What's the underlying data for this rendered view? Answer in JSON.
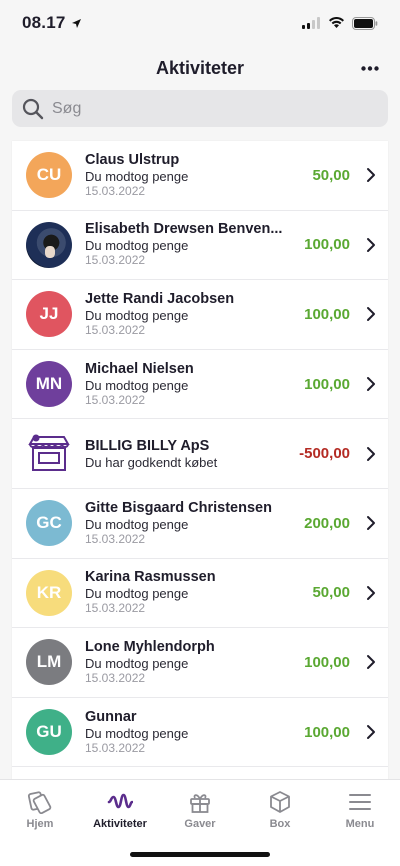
{
  "status_bar": {
    "time": "08.17"
  },
  "header": {
    "title": "Aktiviteter",
    "more_label": "•••"
  },
  "search": {
    "placeholder": "Søg"
  },
  "activities": [
    {
      "initials": "CU",
      "avatar_color": "#f3a65a",
      "name": "Claus Ulstrup",
      "description": "Du modtog penge",
      "date": "15.03.2022",
      "amount": "50,00",
      "type": "positive"
    },
    {
      "initials": "",
      "avatar_color": "photo",
      "name": "Elisabeth Drewsen Benven...",
      "description": "Du modtog penge",
      "date": "15.03.2022",
      "amount": "100,00",
      "type": "positive"
    },
    {
      "initials": "JJ",
      "avatar_color": "#e05560",
      "name": "Jette Randi Jacobsen",
      "description": "Du modtog penge",
      "date": "15.03.2022",
      "amount": "100,00",
      "type": "positive"
    },
    {
      "initials": "MN",
      "avatar_color": "#6f3f9c",
      "name": "Michael Nielsen",
      "description": "Du modtog penge",
      "date": "15.03.2022",
      "amount": "100,00",
      "type": "positive"
    },
    {
      "initials": "",
      "avatar_color": "shop",
      "name": "BILLIG BILLY ApS",
      "description": "Du har godkendt købet",
      "date": "",
      "amount": "-500,00",
      "type": "negative"
    },
    {
      "initials": "GC",
      "avatar_color": "#7cbad2",
      "name": "Gitte Bisgaard Christensen",
      "description": "Du modtog penge",
      "date": "15.03.2022",
      "amount": "200,00",
      "type": "positive"
    },
    {
      "initials": "KR",
      "avatar_color": "#f7dc7c",
      "name": "Karina Rasmussen",
      "description": "Du modtog penge",
      "date": "15.03.2022",
      "amount": "50,00",
      "type": "positive"
    },
    {
      "initials": "LM",
      "avatar_color": "#7b7c80",
      "name": "Lone Myhlendorph",
      "description": "Du modtog penge",
      "date": "15.03.2022",
      "amount": "100,00",
      "type": "positive"
    },
    {
      "initials": "GU",
      "avatar_color": "#3fb088",
      "name": "Gunnar",
      "description": "Du modtog penge",
      "date": "15.03.2022",
      "amount": "100,00",
      "type": "positive"
    }
  ],
  "tabs": [
    {
      "label": "Hjem",
      "icon": "cards-icon",
      "active": false
    },
    {
      "label": "Aktiviteter",
      "icon": "activity-wave-icon",
      "active": true
    },
    {
      "label": "Gaver",
      "icon": "gift-icon",
      "active": false
    },
    {
      "label": "Box",
      "icon": "box-icon",
      "active": false
    },
    {
      "label": "Menu",
      "icon": "menu-icon",
      "active": false
    }
  ],
  "colors": {
    "positive": "#5aa832",
    "negative": "#b42b24",
    "accent": "#5b2d8c"
  }
}
